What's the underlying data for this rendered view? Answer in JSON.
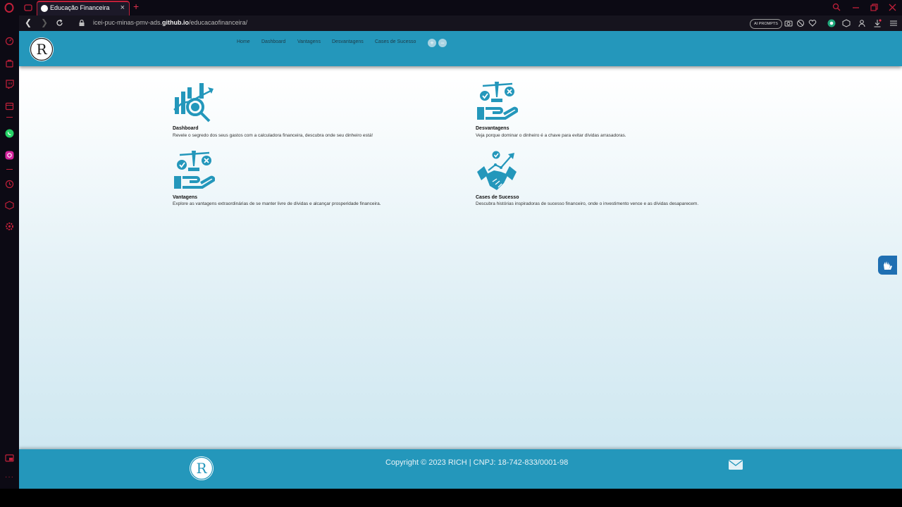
{
  "browser": {
    "tab_title": "Educação Financeira",
    "tab_close": "×",
    "new_tab": "+",
    "url_prefix": "icei-puc-minas-pmv-ads.",
    "url_domain": "github.io",
    "url_path": "/educacaofinanceira/",
    "ai_prompt": "AI PROMPTS",
    "accent_color": "#c2203a"
  },
  "site": {
    "nav": [
      "Home",
      "Dashboard",
      "Vantagens",
      "Desvantagens",
      "Cases de Sucesso"
    ],
    "zoom_in": "+",
    "zoom_out": "−",
    "brand_color": "#2497bb",
    "cards": [
      {
        "title": "Dashboard",
        "desc": "Revele o segredo dos seus gastos com a calculadora financeira, descubra onde seu dinheiro está!",
        "icon": "dashboard-chart-icon"
      },
      {
        "title": "Desvantagens",
        "desc": "Veja porque dominar o dinheiro é a chave para evitar dívidas arrasadoras.",
        "icon": "balance-hand-icon"
      },
      {
        "title": "Vantagens",
        "desc": "Explore as vantagens extraordinárias de se manter livre de dívidas e alcançar prosperidade financeira.",
        "icon": "balance-hand-icon"
      },
      {
        "title": "Cases de Sucesso",
        "desc": "Descubra histórias inspiradoras de sucesso financeiro, onde o investimento vence e as dívidas desaparecem.",
        "icon": "handshake-icon"
      }
    ],
    "footer": {
      "copyright": "Copyright © 2023 RICH | CNPJ: 18-742-833/0001-98"
    }
  }
}
